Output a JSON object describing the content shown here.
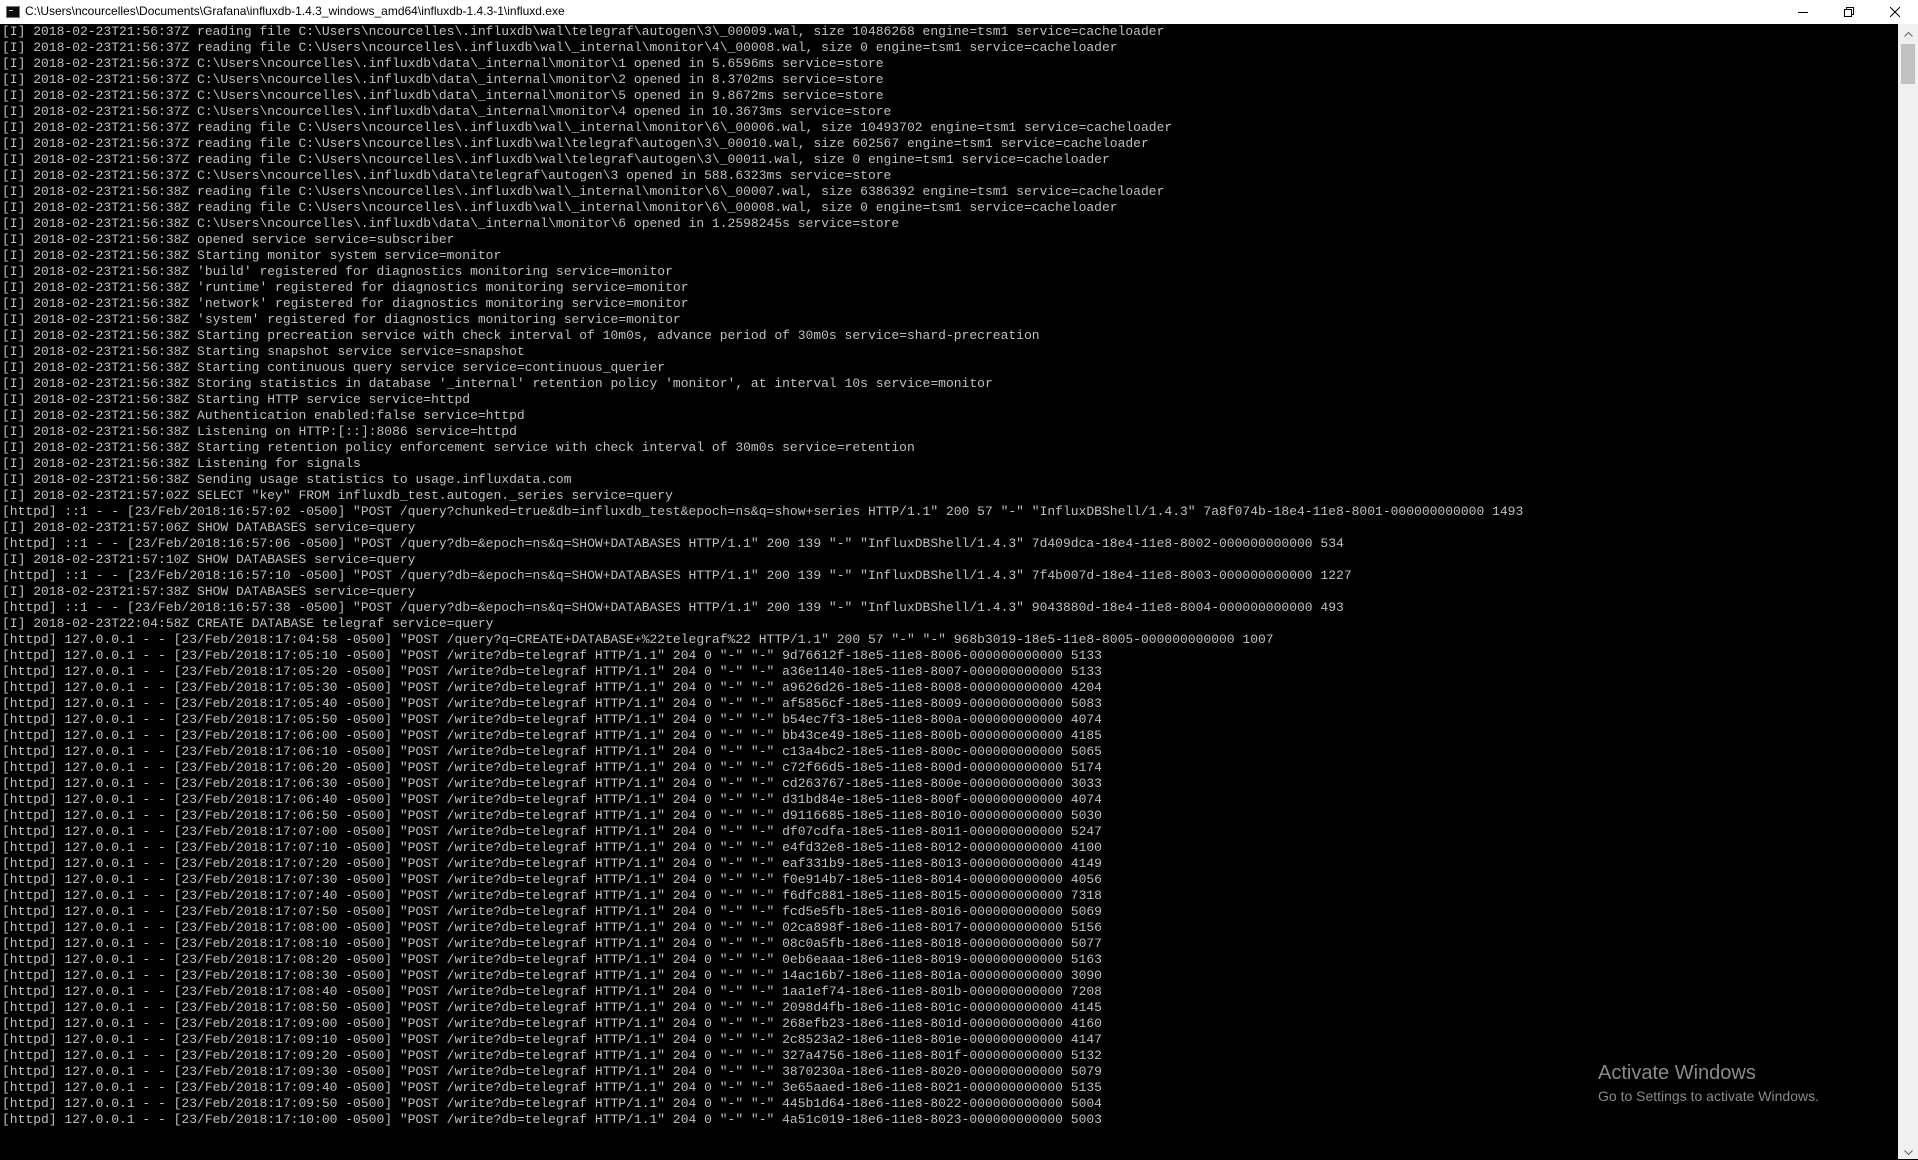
{
  "window": {
    "title": "C:\\Users\\ncourcelles\\Documents\\Grafana\\influxdb-1.4.3_windows_amd64\\influxdb-1.4.3-1\\influxd.exe",
    "icon": "console-app-icon",
    "controls": {
      "minimize_icon": "minimize-icon",
      "maximize_icon": "restore-icon",
      "close_icon": "close-icon"
    }
  },
  "console": {
    "text_color": "#c0c0c0",
    "background": "#000000",
    "lines": [
      "[I] 2018-02-23T21:56:37Z reading file C:\\Users\\ncourcelles\\.influxdb\\wal\\telegraf\\autogen\\3\\_00009.wal, size 10486268 engine=tsm1 service=cacheloader",
      "[I] 2018-02-23T21:56:37Z reading file C:\\Users\\ncourcelles\\.influxdb\\wal\\_internal\\monitor\\4\\_00008.wal, size 0 engine=tsm1 service=cacheloader",
      "[I] 2018-02-23T21:56:37Z C:\\Users\\ncourcelles\\.influxdb\\data\\_internal\\monitor\\1 opened in 5.6596ms service=store",
      "[I] 2018-02-23T21:56:37Z C:\\Users\\ncourcelles\\.influxdb\\data\\_internal\\monitor\\2 opened in 8.3702ms service=store",
      "[I] 2018-02-23T21:56:37Z C:\\Users\\ncourcelles\\.influxdb\\data\\_internal\\monitor\\5 opened in 9.8672ms service=store",
      "[I] 2018-02-23T21:56:37Z C:\\Users\\ncourcelles\\.influxdb\\data\\_internal\\monitor\\4 opened in 10.3673ms service=store",
      "[I] 2018-02-23T21:56:37Z reading file C:\\Users\\ncourcelles\\.influxdb\\wal\\_internal\\monitor\\6\\_00006.wal, size 10493702 engine=tsm1 service=cacheloader",
      "[I] 2018-02-23T21:56:37Z reading file C:\\Users\\ncourcelles\\.influxdb\\wal\\telegraf\\autogen\\3\\_00010.wal, size 602567 engine=tsm1 service=cacheloader",
      "[I] 2018-02-23T21:56:37Z reading file C:\\Users\\ncourcelles\\.influxdb\\wal\\telegraf\\autogen\\3\\_00011.wal, size 0 engine=tsm1 service=cacheloader",
      "[I] 2018-02-23T21:56:37Z C:\\Users\\ncourcelles\\.influxdb\\data\\telegraf\\autogen\\3 opened in 588.6323ms service=store",
      "[I] 2018-02-23T21:56:38Z reading file C:\\Users\\ncourcelles\\.influxdb\\wal\\_internal\\monitor\\6\\_00007.wal, size 6386392 engine=tsm1 service=cacheloader",
      "[I] 2018-02-23T21:56:38Z reading file C:\\Users\\ncourcelles\\.influxdb\\wal\\_internal\\monitor\\6\\_00008.wal, size 0 engine=tsm1 service=cacheloader",
      "[I] 2018-02-23T21:56:38Z C:\\Users\\ncourcelles\\.influxdb\\data\\_internal\\monitor\\6 opened in 1.2598245s service=store",
      "[I] 2018-02-23T21:56:38Z opened service service=subscriber",
      "[I] 2018-02-23T21:56:38Z Starting monitor system service=monitor",
      "[I] 2018-02-23T21:56:38Z 'build' registered for diagnostics monitoring service=monitor",
      "[I] 2018-02-23T21:56:38Z 'runtime' registered for diagnostics monitoring service=monitor",
      "[I] 2018-02-23T21:56:38Z 'network' registered for diagnostics monitoring service=monitor",
      "[I] 2018-02-23T21:56:38Z 'system' registered for diagnostics monitoring service=monitor",
      "[I] 2018-02-23T21:56:38Z Starting precreation service with check interval of 10m0s, advance period of 30m0s service=shard-precreation",
      "[I] 2018-02-23T21:56:38Z Starting snapshot service service=snapshot",
      "[I] 2018-02-23T21:56:38Z Starting continuous query service service=continuous_querier",
      "[I] 2018-02-23T21:56:38Z Storing statistics in database '_internal' retention policy 'monitor', at interval 10s service=monitor",
      "[I] 2018-02-23T21:56:38Z Starting HTTP service service=httpd",
      "[I] 2018-02-23T21:56:38Z Authentication enabled:false service=httpd",
      "[I] 2018-02-23T21:56:38Z Listening on HTTP:[::]:8086 service=httpd",
      "[I] 2018-02-23T21:56:38Z Starting retention policy enforcement service with check interval of 30m0s service=retention",
      "[I] 2018-02-23T21:56:38Z Listening for signals",
      "[I] 2018-02-23T21:56:38Z Sending usage statistics to usage.influxdata.com",
      "[I] 2018-02-23T21:57:02Z SELECT \"key\" FROM influxdb_test.autogen._series service=query",
      "[httpd] ::1 - - [23/Feb/2018:16:57:02 -0500] \"POST /query?chunked=true&db=influxdb_test&epoch=ns&q=show+series HTTP/1.1\" 200 57 \"-\" \"InfluxDBShell/1.4.3\" 7a8f074b-18e4-11e8-8001-000000000000 1493",
      "[I] 2018-02-23T21:57:06Z SHOW DATABASES service=query",
      "[httpd] ::1 - - [23/Feb/2018:16:57:06 -0500] \"POST /query?db=&epoch=ns&q=SHOW+DATABASES HTTP/1.1\" 200 139 \"-\" \"InfluxDBShell/1.4.3\" 7d409dca-18e4-11e8-8002-000000000000 534",
      "[I] 2018-02-23T21:57:10Z SHOW DATABASES service=query",
      "[httpd] ::1 - - [23/Feb/2018:16:57:10 -0500] \"POST /query?db=&epoch=ns&q=SHOW+DATABASES HTTP/1.1\" 200 139 \"-\" \"InfluxDBShell/1.4.3\" 7f4b007d-18e4-11e8-8003-000000000000 1227",
      "[I] 2018-02-23T21:57:38Z SHOW DATABASES service=query",
      "[httpd] ::1 - - [23/Feb/2018:16:57:38 -0500] \"POST /query?db=&epoch=ns&q=SHOW+DATABASES HTTP/1.1\" 200 139 \"-\" \"InfluxDBShell/1.4.3\" 9043880d-18e4-11e8-8004-000000000000 493",
      "[I] 2018-02-23T22:04:58Z CREATE DATABASE telegraf service=query",
      "[httpd] 127.0.0.1 - - [23/Feb/2018:17:04:58 -0500] \"POST /query?q=CREATE+DATABASE+%22telegraf%22 HTTP/1.1\" 200 57 \"-\" \"-\" 968b3019-18e5-11e8-8005-000000000000 1007",
      "[httpd] 127.0.0.1 - - [23/Feb/2018:17:05:10 -0500] \"POST /write?db=telegraf HTTP/1.1\" 204 0 \"-\" \"-\" 9d76612f-18e5-11e8-8006-000000000000 5133",
      "[httpd] 127.0.0.1 - - [23/Feb/2018:17:05:20 -0500] \"POST /write?db=telegraf HTTP/1.1\" 204 0 \"-\" \"-\" a36e1140-18e5-11e8-8007-000000000000 5133",
      "[httpd] 127.0.0.1 - - [23/Feb/2018:17:05:30 -0500] \"POST /write?db=telegraf HTTP/1.1\" 204 0 \"-\" \"-\" a9626d26-18e5-11e8-8008-000000000000 4204",
      "[httpd] 127.0.0.1 - - [23/Feb/2018:17:05:40 -0500] \"POST /write?db=telegraf HTTP/1.1\" 204 0 \"-\" \"-\" af5856cf-18e5-11e8-8009-000000000000 5083",
      "[httpd] 127.0.0.1 - - [23/Feb/2018:17:05:50 -0500] \"POST /write?db=telegraf HTTP/1.1\" 204 0 \"-\" \"-\" b54ec7f3-18e5-11e8-800a-000000000000 4074",
      "[httpd] 127.0.0.1 - - [23/Feb/2018:17:06:00 -0500] \"POST /write?db=telegraf HTTP/1.1\" 204 0 \"-\" \"-\" bb43ce49-18e5-11e8-800b-000000000000 4185",
      "[httpd] 127.0.0.1 - - [23/Feb/2018:17:06:10 -0500] \"POST /write?db=telegraf HTTP/1.1\" 204 0 \"-\" \"-\" c13a4bc2-18e5-11e8-800c-000000000000 5065",
      "[httpd] 127.0.0.1 - - [23/Feb/2018:17:06:20 -0500] \"POST /write?db=telegraf HTTP/1.1\" 204 0 \"-\" \"-\" c72f66d5-18e5-11e8-800d-000000000000 5174",
      "[httpd] 127.0.0.1 - - [23/Feb/2018:17:06:30 -0500] \"POST /write?db=telegraf HTTP/1.1\" 204 0 \"-\" \"-\" cd263767-18e5-11e8-800e-000000000000 3033",
      "[httpd] 127.0.0.1 - - [23/Feb/2018:17:06:40 -0500] \"POST /write?db=telegraf HTTP/1.1\" 204 0 \"-\" \"-\" d31bd84e-18e5-11e8-800f-000000000000 4074",
      "[httpd] 127.0.0.1 - - [23/Feb/2018:17:06:50 -0500] \"POST /write?db=telegraf HTTP/1.1\" 204 0 \"-\" \"-\" d9116685-18e5-11e8-8010-000000000000 5030",
      "[httpd] 127.0.0.1 - - [23/Feb/2018:17:07:00 -0500] \"POST /write?db=telegraf HTTP/1.1\" 204 0 \"-\" \"-\" df07cdfa-18e5-11e8-8011-000000000000 5247",
      "[httpd] 127.0.0.1 - - [23/Feb/2018:17:07:10 -0500] \"POST /write?db=telegraf HTTP/1.1\" 204 0 \"-\" \"-\" e4fd32e8-18e5-11e8-8012-000000000000 4100",
      "[httpd] 127.0.0.1 - - [23/Feb/2018:17:07:20 -0500] \"POST /write?db=telegraf HTTP/1.1\" 204 0 \"-\" \"-\" eaf331b9-18e5-11e8-8013-000000000000 4149",
      "[httpd] 127.0.0.1 - - [23/Feb/2018:17:07:30 -0500] \"POST /write?db=telegraf HTTP/1.1\" 204 0 \"-\" \"-\" f0e914b7-18e5-11e8-8014-000000000000 4056",
      "[httpd] 127.0.0.1 - - [23/Feb/2018:17:07:40 -0500] \"POST /write?db=telegraf HTTP/1.1\" 204 0 \"-\" \"-\" f6dfc881-18e5-11e8-8015-000000000000 7318",
      "[httpd] 127.0.0.1 - - [23/Feb/2018:17:07:50 -0500] \"POST /write?db=telegraf HTTP/1.1\" 204 0 \"-\" \"-\" fcd5e5fb-18e5-11e8-8016-000000000000 5069",
      "[httpd] 127.0.0.1 - - [23/Feb/2018:17:08:00 -0500] \"POST /write?db=telegraf HTTP/1.1\" 204 0 \"-\" \"-\" 02ca898f-18e6-11e8-8017-000000000000 5156",
      "[httpd] 127.0.0.1 - - [23/Feb/2018:17:08:10 -0500] \"POST /write?db=telegraf HTTP/1.1\" 204 0 \"-\" \"-\" 08c0a5fb-18e6-11e8-8018-000000000000 5077",
      "[httpd] 127.0.0.1 - - [23/Feb/2018:17:08:20 -0500] \"POST /write?db=telegraf HTTP/1.1\" 204 0 \"-\" \"-\" 0eb6eaaa-18e6-11e8-8019-000000000000 5163",
      "[httpd] 127.0.0.1 - - [23/Feb/2018:17:08:30 -0500] \"POST /write?db=telegraf HTTP/1.1\" 204 0 \"-\" \"-\" 14ac16b7-18e6-11e8-801a-000000000000 3090",
      "[httpd] 127.0.0.1 - - [23/Feb/2018:17:08:40 -0500] \"POST /write?db=telegraf HTTP/1.1\" 204 0 \"-\" \"-\" 1aa1ef74-18e6-11e8-801b-000000000000 7208",
      "[httpd] 127.0.0.1 - - [23/Feb/2018:17:08:50 -0500] \"POST /write?db=telegraf HTTP/1.1\" 204 0 \"-\" \"-\" 2098d4fb-18e6-11e8-801c-000000000000 4145",
      "[httpd] 127.0.0.1 - - [23/Feb/2018:17:09:00 -0500] \"POST /write?db=telegraf HTTP/1.1\" 204 0 \"-\" \"-\" 268efb23-18e6-11e8-801d-000000000000 4160",
      "[httpd] 127.0.0.1 - - [23/Feb/2018:17:09:10 -0500] \"POST /write?db=telegraf HTTP/1.1\" 204 0 \"-\" \"-\" 2c8523a2-18e6-11e8-801e-000000000000 4147",
      "[httpd] 127.0.0.1 - - [23/Feb/2018:17:09:20 -0500] \"POST /write?db=telegraf HTTP/1.1\" 204 0 \"-\" \"-\" 327a4756-18e6-11e8-801f-000000000000 5132",
      "[httpd] 127.0.0.1 - - [23/Feb/2018:17:09:30 -0500] \"POST /write?db=telegraf HTTP/1.1\" 204 0 \"-\" \"-\" 3870230a-18e6-11e8-8020-000000000000 5079",
      "[httpd] 127.0.0.1 - - [23/Feb/2018:17:09:40 -0500] \"POST /write?db=telegraf HTTP/1.1\" 204 0 \"-\" \"-\" 3e65aaed-18e6-11e8-8021-000000000000 5135",
      "[httpd] 127.0.0.1 - - [23/Feb/2018:17:09:50 -0500] \"POST /write?db=telegraf HTTP/1.1\" 204 0 \"-\" \"-\" 445b1d64-18e6-11e8-8022-000000000000 5004",
      "[httpd] 127.0.0.1 - - [23/Feb/2018:17:10:00 -0500] \"POST /write?db=telegraf HTTP/1.1\" 204 0 \"-\" \"-\" 4a51c019-18e6-11e8-8023-000000000000 5003"
    ]
  },
  "watermark": {
    "title": "Activate Windows",
    "subtitle": "Go to Settings to activate Windows."
  },
  "scrollbar": {
    "up_icon": "scroll-up-arrow-icon",
    "down_icon": "scroll-down-arrow-icon"
  }
}
